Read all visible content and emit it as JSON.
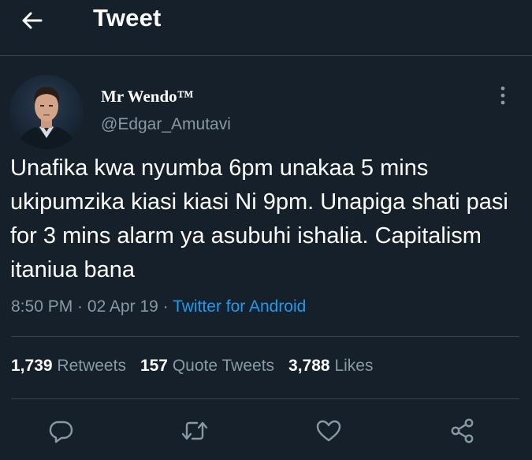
{
  "header": {
    "back_icon": "arrow-left-icon",
    "title": "Tweet"
  },
  "author": {
    "name": "Mr Wendo™",
    "handle": "@Edgar_Amutavi"
  },
  "tweet": {
    "text": "Unafika kwa nyumba 6pm unakaa 5 mins ukipumzika kiasi kiasi Ni 9pm. Unapiga shati pasi for 3 mins alarm ya asubuhi ishalia. Capitalism itaniua bana",
    "time": "8:50 PM",
    "separator": " · ",
    "date": "02 Apr 19",
    "source": "Twitter for Android"
  },
  "stats": {
    "retweets_count": "1,739",
    "retweets_label": "Retweets",
    "quotes_count": "157",
    "quotes_label": "Quote Tweets",
    "likes_count": "3,788",
    "likes_label": "Likes"
  },
  "actions": [
    "reply-icon",
    "retweet-icon",
    "like-icon",
    "share-icon"
  ],
  "colors": {
    "background": "#15202b",
    "text": "#ffffff",
    "secondary": "#8899a6",
    "accent": "#1d9bf0",
    "border": "#38444d"
  }
}
